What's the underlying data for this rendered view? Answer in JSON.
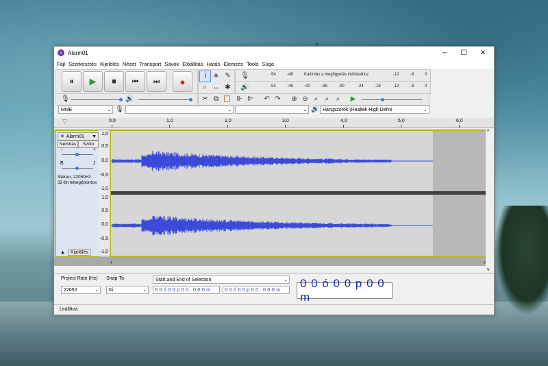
{
  "window": {
    "title": "Alarm01",
    "minimize": "─",
    "maximize": "☐",
    "close": "✕"
  },
  "menu": [
    "Fájl",
    "Szerkesztés",
    "Kijelölés",
    "Nézet",
    "Transport",
    "Sávok",
    "Előállítás",
    "Hatás",
    "Elemzés",
    "Tools",
    "Súgó"
  ],
  "transport": {
    "pause": "⏸",
    "play": "▶",
    "stop": "■",
    "skip_start": "⏮",
    "skip_end": "⏭",
    "record": "●"
  },
  "meters": {
    "record_labels": [
      "-54",
      "-48",
      "Kattintás a megfigyelés indításához",
      "-12",
      "-6",
      "0"
    ],
    "play_labels": [
      "-54",
      "-48",
      "-42",
      "-36",
      "-30",
      "-24",
      "-18",
      "-12",
      "-6",
      "0"
    ]
  },
  "devices": {
    "host": "MME",
    "input": "",
    "channels": "",
    "output": "Hangszórók (Realtek High Defini"
  },
  "ruler": {
    "labels": [
      "0,0",
      "1,0",
      "2,0",
      "3,0",
      "4,0",
      "5,0",
      "6,0"
    ]
  },
  "track": {
    "name": "Alarm01",
    "mute": "Némítás",
    "solo": "Szóló",
    "gain_minus": "−",
    "gain_plus": "+",
    "pan_left": "B",
    "pan_right": "J",
    "info": "Stereo, 22050Hz",
    "format": "32-bit lebegőpontos",
    "select": "Kijelölés",
    "scale": [
      "1,0",
      "0,5",
      "0,0",
      "-0,5",
      "-1,0"
    ]
  },
  "selection_toolbar": {
    "rate_label": "Project Rate (Hz)",
    "rate_value": "22050",
    "snap_label": "Snap-To",
    "snap_value": "Ki",
    "selection_mode": "Start and End of Selection",
    "start_time": "0 0 ó 0 0 p 0 0 . 0 0 0 m",
    "end_time": "0 0 ó 0 0 p 0 0 . 0 0 0 m",
    "audio_position": "0 0 ó 0 0 p 0 0 m"
  },
  "status": {
    "text": "Leállítva."
  },
  "colors": {
    "waveform": "#3b4bd8",
    "clip_background": "#d6d6d6",
    "track_border": "#b5b200"
  }
}
